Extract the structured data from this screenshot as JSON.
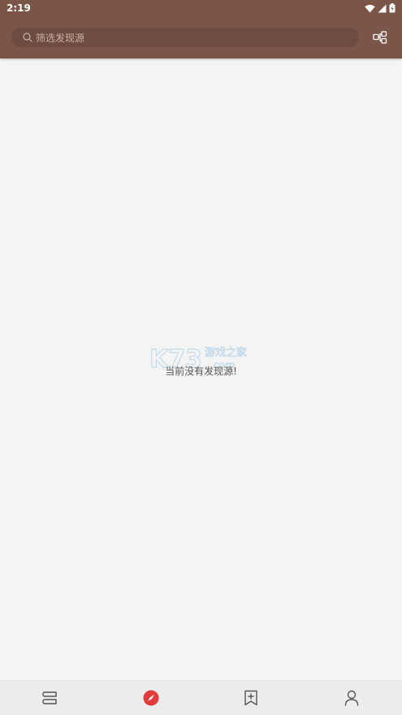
{
  "status_bar": {
    "time": "2:19"
  },
  "search": {
    "placeholder": "筛选发现源"
  },
  "content": {
    "empty_message": "当前没有发现源!"
  },
  "watermark": {
    "brand": "K73",
    "site": "游戏之家",
    "domain": ".com"
  },
  "bottom_nav": {
    "items": [
      {
        "icon": "bookshelf-icon",
        "active": false
      },
      {
        "icon": "compass-icon",
        "active": true
      },
      {
        "icon": "bookmark-add-icon",
        "active": false
      },
      {
        "icon": "person-icon",
        "active": false
      }
    ]
  },
  "colors": {
    "primary": "#7b5548",
    "accent": "#e23b3b",
    "background": "#f4f4f4"
  }
}
